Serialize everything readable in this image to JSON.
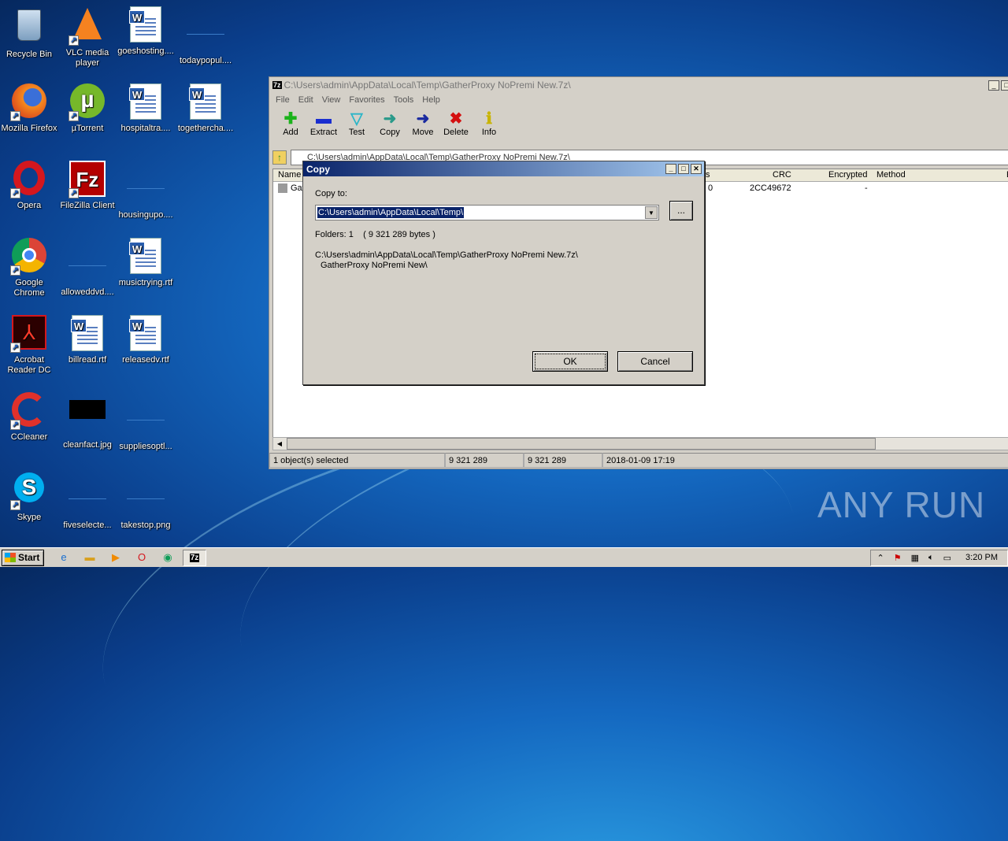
{
  "desktop": {
    "icons": [
      {
        "label": "Recycle Bin",
        "icon": "recycle-bin-icon"
      },
      {
        "label": "VLC media player",
        "icon": "vlc-icon"
      },
      {
        "label": "goeshosting....",
        "icon": "word-doc-icon"
      },
      {
        "label": "todaypopul....",
        "icon": "blank-file-icon"
      },
      {
        "label": "Mozilla Firefox",
        "icon": "firefox-icon"
      },
      {
        "label": "µTorrent",
        "icon": "utorrent-icon"
      },
      {
        "label": "hospitaltra....",
        "icon": "word-doc-icon"
      },
      {
        "label": "togethercha....",
        "icon": "word-doc-icon"
      },
      {
        "label": "Opera",
        "icon": "opera-icon"
      },
      {
        "label": "FileZilla Client",
        "icon": "filezilla-icon"
      },
      {
        "label": "housingupo....",
        "icon": "blank-file-icon"
      },
      {
        "label": "Google Chrome",
        "icon": "chrome-icon"
      },
      {
        "label": "alloweddvd....",
        "icon": "blank-file-icon"
      },
      {
        "label": "musictrying.rtf",
        "icon": "word-doc-icon"
      },
      {
        "label": "Acrobat Reader DC",
        "icon": "acrobat-icon"
      },
      {
        "label": "billread.rtf",
        "icon": "word-doc-icon"
      },
      {
        "label": "releasedv.rtf",
        "icon": "word-doc-icon"
      },
      {
        "label": "CCleaner",
        "icon": "ccleaner-icon"
      },
      {
        "label": "cleanfact.jpg",
        "icon": "image-file-icon"
      },
      {
        "label": "suppliesoptl...",
        "icon": "blank-file-icon"
      },
      {
        "label": "Skype",
        "icon": "skype-icon"
      },
      {
        "label": "fiveselecte...",
        "icon": "blank-file-icon"
      },
      {
        "label": "takestop.png",
        "icon": "blank-file-icon"
      }
    ],
    "watermark": "ANY RUN"
  },
  "window": {
    "title": "C:\\Users\\admin\\AppData\\Local\\Temp\\GatherProxy NoPremi New.7z\\",
    "menu": [
      "File",
      "Edit",
      "View",
      "Favorites",
      "Tools",
      "Help"
    ],
    "toolbar": [
      "Add",
      "Extract",
      "Test",
      "Copy",
      "Move",
      "Delete",
      "Info"
    ],
    "address": "C:\\Users\\admin\\AppData\\Local\\Temp\\GatherProxy NoPremi New.7z\\",
    "columns": {
      "name": "Name",
      "s": "s",
      "crc": "CRC",
      "encrypted": "Encrypted",
      "method": "Method",
      "e": "E"
    },
    "row": {
      "name": "Gat",
      "s": "0",
      "crc": "2CC49672",
      "encrypted": "-"
    },
    "status": {
      "selected": "1 object(s) selected",
      "size": "9 321 289",
      "packed": "9 321 289",
      "date": "2018-01-09 17:19"
    }
  },
  "dialog": {
    "title": "Copy",
    "copy_to_label": "Copy to:",
    "path": "C:\\Users\\admin\\AppData\\Local\\Temp\\",
    "browse": "...",
    "folders": "Folders: 1    ( 9 321 289 bytes )",
    "source_line1": "C:\\Users\\admin\\AppData\\Local\\Temp\\GatherProxy NoPremi New.7z\\",
    "source_line2": "GatherProxy NoPremi New\\",
    "ok": "OK",
    "cancel": "Cancel"
  },
  "taskbar": {
    "start": "Start",
    "clock": "3:20 PM",
    "app": "7z"
  }
}
